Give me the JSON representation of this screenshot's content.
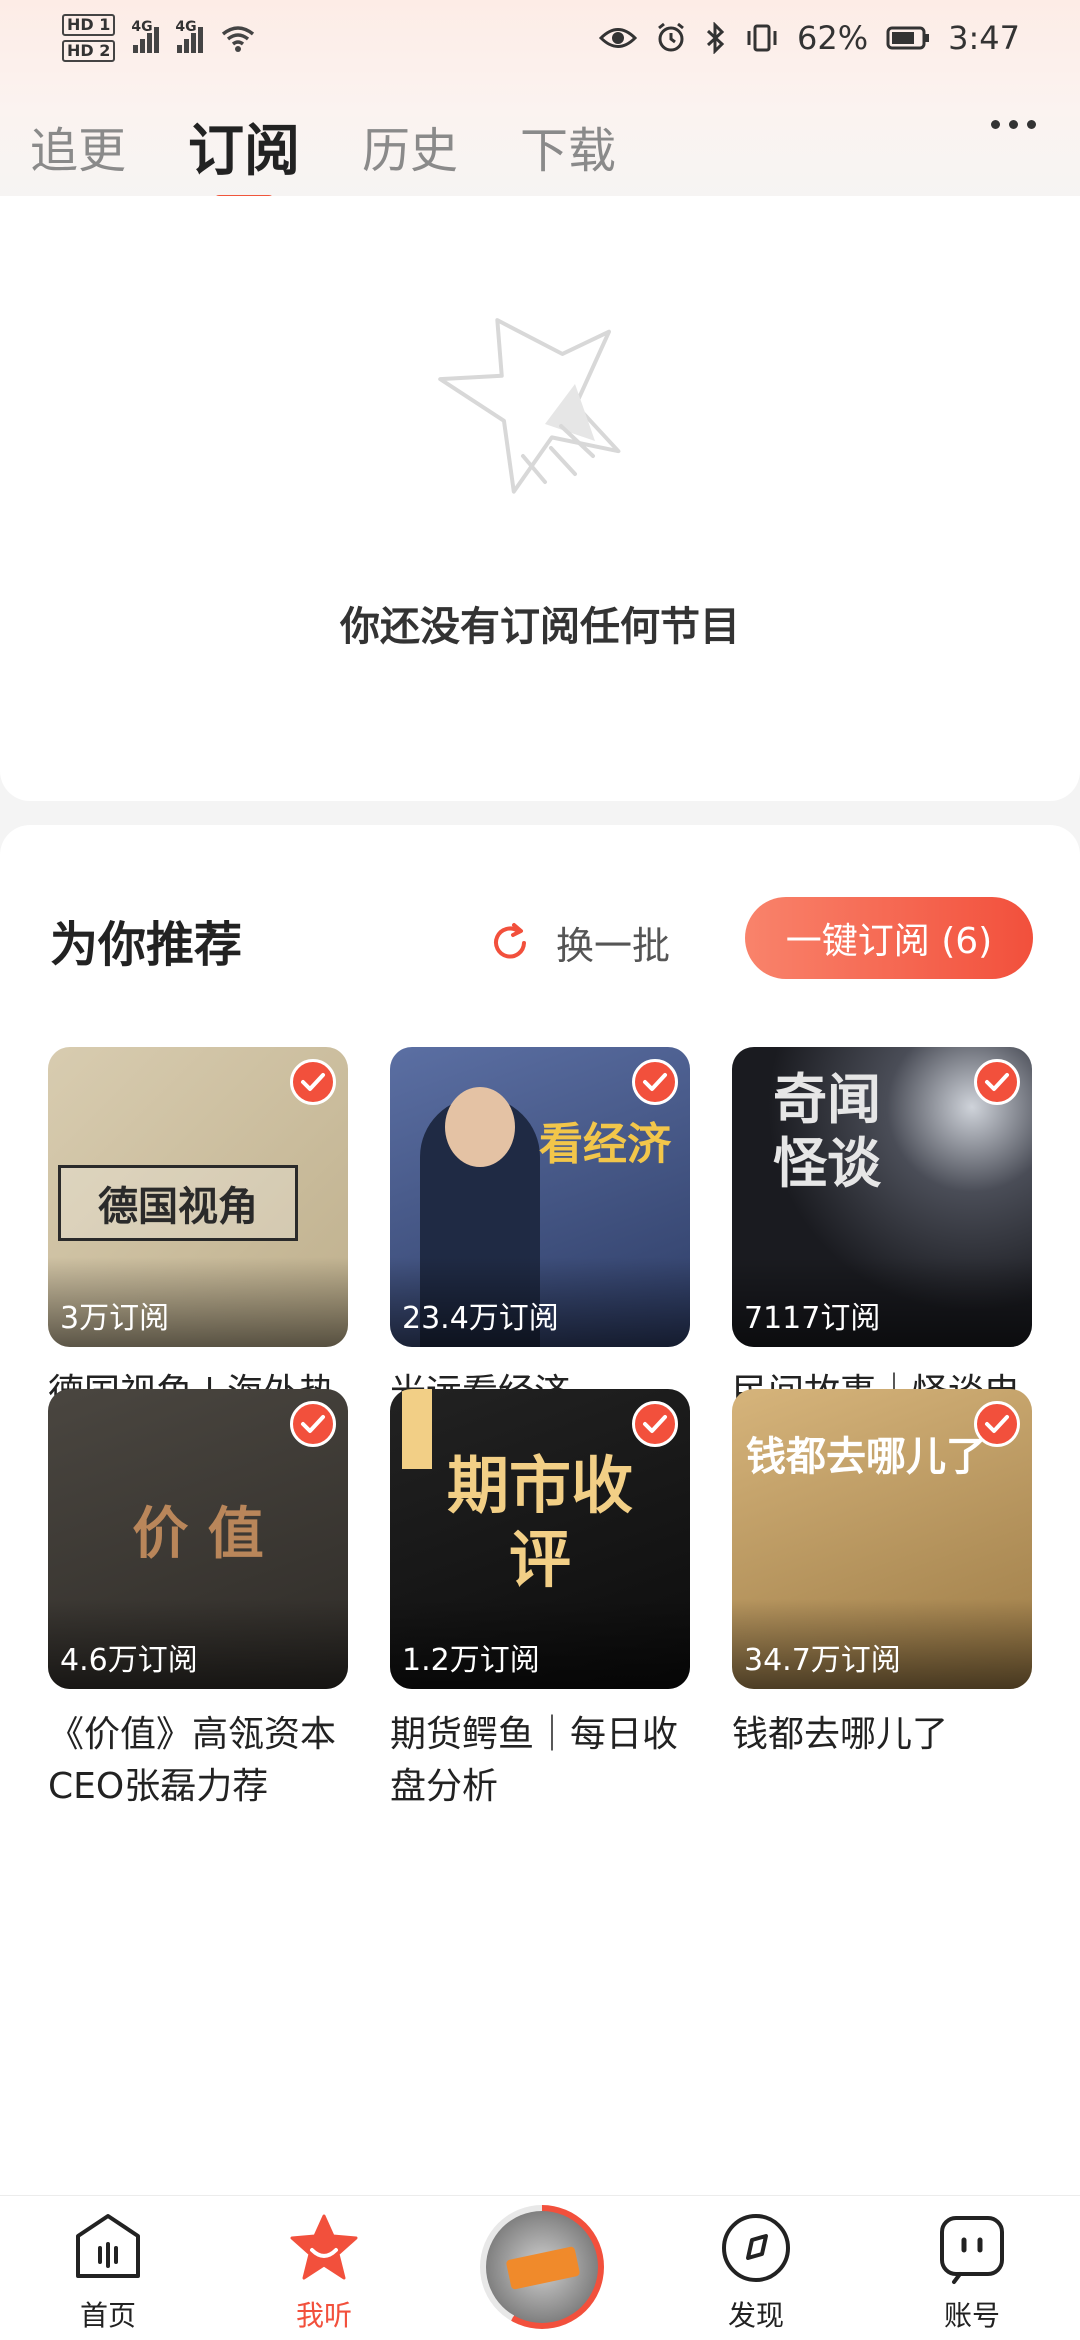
{
  "status_bar": {
    "hd1": "HD 1",
    "hd2": "HD 2",
    "net1": "4G",
    "net2": "4G",
    "battery": "62%",
    "time": "3:47"
  },
  "tabs": [
    {
      "label": "追更"
    },
    {
      "label": "订阅"
    },
    {
      "label": "历史"
    },
    {
      "label": "下载"
    }
  ],
  "empty": {
    "message": "你还没有订阅任何节目"
  },
  "recommend": {
    "title": "为你推荐",
    "refresh_label": "换一批",
    "subscribe_all_label": "一键订阅 (6)",
    "items": [
      {
        "name": "德国视角 | 海外热点故事传奇",
        "count": "3万订阅",
        "cover_text": "德国视角",
        "cover_bg": "#cdbf9f",
        "cover_fg": "#2a2a2a"
      },
      {
        "name": "光远看经济",
        "count": "23.4万订阅",
        "cover_text": "看经济",
        "cover_bg": "#3c4f7e",
        "cover_fg": "#f2c64a"
      },
      {
        "name": "民间故事｜怪谈电台｜天夏诡语",
        "count": "7117订阅",
        "cover_text": "奇闻怪谈",
        "cover_bg": "#1c1c22",
        "cover_fg": "#e6e6e6"
      },
      {
        "name": "《价值》高瓴资本CEO张磊力荐",
        "count": "4.6万订阅",
        "cover_text": "价 值",
        "cover_bg": "#3d3a36",
        "cover_fg": "#b9865a"
      },
      {
        "name": "期货鳄鱼｜每日收盘分析",
        "count": "1.2万订阅",
        "cover_text": "期市收评",
        "cover_bg": "#151515",
        "cover_fg": "#f2cf86"
      },
      {
        "name": "钱都去哪儿了",
        "count": "34.7万订阅",
        "cover_text": "钱都去哪儿了",
        "cover_bg": "#c7a46a",
        "cover_fg": "#ffffff"
      }
    ]
  },
  "bottom_nav": [
    {
      "label": "首页"
    },
    {
      "label": "我听"
    },
    {
      "label": "发现"
    },
    {
      "label": "账号"
    }
  ],
  "colors": {
    "accent": "#f2503c",
    "tab_inactive": "#8a8a8a"
  }
}
